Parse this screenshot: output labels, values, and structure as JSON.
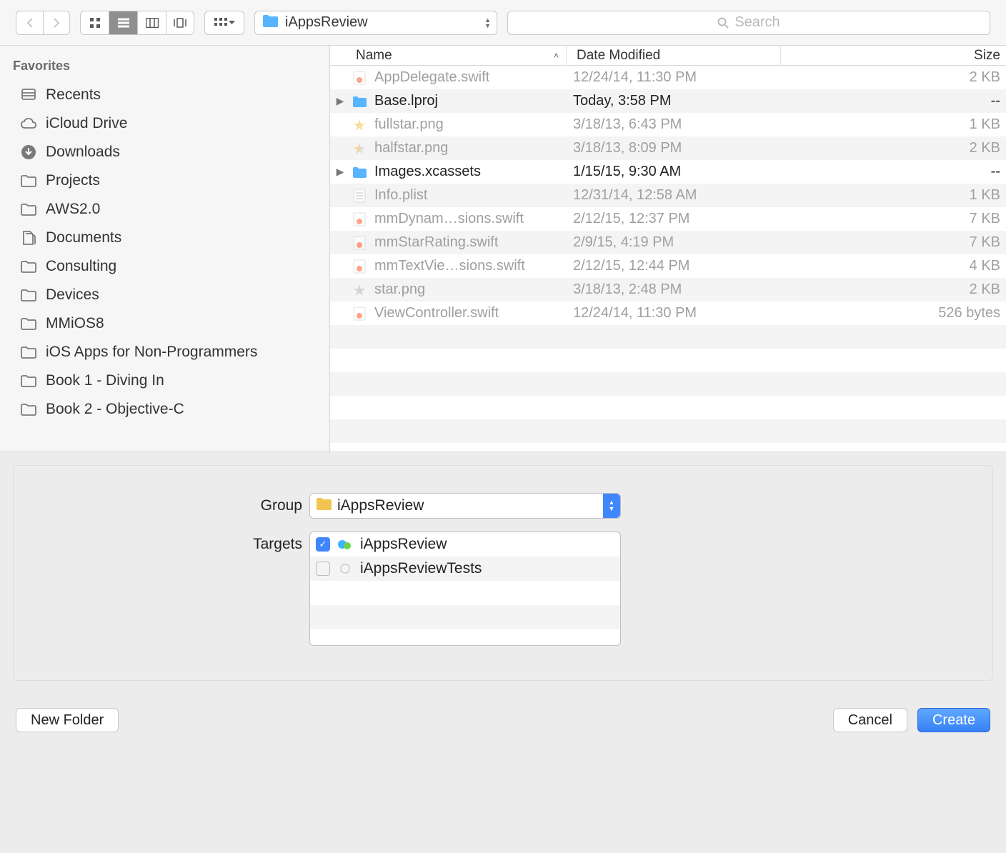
{
  "toolbar": {
    "path_label": "iAppsReview",
    "search_placeholder": "Search"
  },
  "sidebar": {
    "header": "Favorites",
    "items": [
      {
        "icon": "recents",
        "label": "Recents"
      },
      {
        "icon": "cloud",
        "label": "iCloud Drive"
      },
      {
        "icon": "download",
        "label": "Downloads"
      },
      {
        "icon": "folder",
        "label": "Projects"
      },
      {
        "icon": "folder",
        "label": "AWS2.0"
      },
      {
        "icon": "documents",
        "label": "Documents"
      },
      {
        "icon": "folder",
        "label": "Consulting"
      },
      {
        "icon": "folder",
        "label": "Devices"
      },
      {
        "icon": "folder",
        "label": "MMiOS8"
      },
      {
        "icon": "folder",
        "label": "iOS Apps for Non-Programmers"
      },
      {
        "icon": "folder",
        "label": "Book 1 - Diving In"
      },
      {
        "icon": "folder",
        "label": "Book 2 - Objective-C"
      }
    ]
  },
  "columns": {
    "name": "Name",
    "date": "Date Modified",
    "size": "Size"
  },
  "files": [
    {
      "disclosure": "",
      "icon": "swift",
      "name": "AppDelegate.swift",
      "date": "12/24/14, 11:30 PM",
      "size": "2 KB",
      "enabled": false
    },
    {
      "disclosure": "▶",
      "icon": "folder",
      "name": "Base.lproj",
      "date": "Today, 3:58 PM",
      "size": "--",
      "enabled": true
    },
    {
      "disclosure": "",
      "icon": "fullstar",
      "name": "fullstar.png",
      "date": "3/18/13, 6:43 PM",
      "size": "1 KB",
      "enabled": false
    },
    {
      "disclosure": "",
      "icon": "halfstar",
      "name": "halfstar.png",
      "date": "3/18/13, 8:09 PM",
      "size": "2 KB",
      "enabled": false
    },
    {
      "disclosure": "▶",
      "icon": "folder",
      "name": "Images.xcassets",
      "date": "1/15/15, 9:30 AM",
      "size": "--",
      "enabled": true
    },
    {
      "disclosure": "",
      "icon": "plist",
      "name": "Info.plist",
      "date": "12/31/14, 12:58 AM",
      "size": "1 KB",
      "enabled": false
    },
    {
      "disclosure": "",
      "icon": "swift",
      "name": "mmDynam…sions.swift",
      "date": "2/12/15, 12:37 PM",
      "size": "7 KB",
      "enabled": false
    },
    {
      "disclosure": "",
      "icon": "swift",
      "name": "mmStarRating.swift",
      "date": "2/9/15, 4:19 PM",
      "size": "7 KB",
      "enabled": false
    },
    {
      "disclosure": "",
      "icon": "swift",
      "name": "mmTextVie…sions.swift",
      "date": "2/12/15, 12:44 PM",
      "size": "4 KB",
      "enabled": false
    },
    {
      "disclosure": "",
      "icon": "star",
      "name": "star.png",
      "date": "3/18/13, 2:48 PM",
      "size": "2 KB",
      "enabled": false
    },
    {
      "disclosure": "",
      "icon": "swift",
      "name": "ViewController.swift",
      "date": "12/24/14, 11:30 PM",
      "size": "526 bytes",
      "enabled": false
    }
  ],
  "group": {
    "label": "Group",
    "value": "iAppsReview"
  },
  "targets": {
    "label": "Targets",
    "items": [
      {
        "checked": true,
        "icon": "app",
        "name": "iAppsReview"
      },
      {
        "checked": false,
        "icon": "test",
        "name": "iAppsReviewTests"
      }
    ]
  },
  "footer": {
    "new_folder": "New Folder",
    "cancel": "Cancel",
    "create": "Create"
  }
}
